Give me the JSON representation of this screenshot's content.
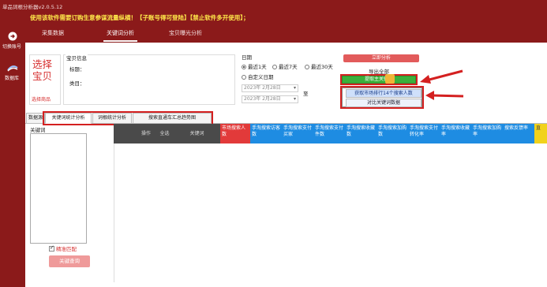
{
  "app": {
    "title": "单品词根分析器v2.0.5.12",
    "warning": "使用该软件需要订购生意参谋流量纵横！【子账号得可登陆】【禁止软件多开使用】；"
  },
  "sidebar": {
    "items": [
      {
        "label": "切换账号",
        "icon": "switch-account-icon"
      },
      {
        "label": "数据库",
        "icon": "database-icon"
      }
    ]
  },
  "nav": {
    "tabs": [
      {
        "label": "采集数据"
      },
      {
        "label": "关键词分析",
        "active": true
      },
      {
        "label": "宝贝曝光分析"
      }
    ]
  },
  "product": {
    "select_big": "选择宝贝",
    "select_small": "选择商品",
    "info_label": "宝贝信息",
    "title_label": "标题：",
    "category_label": "类目："
  },
  "date": {
    "label": "日期",
    "options": [
      "最近1天",
      "最近7天",
      "最近30天",
      "自定义日期"
    ],
    "selected": "最近1天",
    "start": "2023年  2月28日",
    "end": "2023年  2月28日",
    "to": "至"
  },
  "actions": {
    "analyze": "立即分析",
    "export": "导出全部",
    "copy": "提取主关键词",
    "menu_items": [
      "获取市场排行14个搜索人数",
      "对比关键词数据"
    ]
  },
  "subtabs": [
    {
      "label": "数据源"
    },
    {
      "label": "关键词统计分析",
      "active": true
    },
    {
      "label": "词根统计分析"
    },
    {
      "label": "搜索直通车汇总趋势图"
    }
  ],
  "keyword_panel": {
    "label": "关键词",
    "checkbox": "精准匹配",
    "search_button": "关键查询"
  },
  "grid": {
    "columns": [
      {
        "label": "",
        "color": "dark"
      },
      {
        "label": "操作",
        "color": "dark"
      },
      {
        "label": "全选",
        "color": "dark"
      },
      {
        "label": "关键词",
        "color": "dark"
      },
      {
        "label": "市场搜索人数",
        "color": "red"
      },
      {
        "label": "手淘搜索访客数",
        "color": "blue"
      },
      {
        "label": "手淘搜索支付买家",
        "color": "blue"
      },
      {
        "label": "手淘搜索支付件数",
        "color": "blue"
      },
      {
        "label": "手淘搜索收藏数",
        "color": "blue"
      },
      {
        "label": "手淘搜索加购数",
        "color": "blue"
      },
      {
        "label": "手淘搜索支付转化率",
        "color": "blue"
      },
      {
        "label": "手淘搜索收藏率",
        "color": "blue"
      },
      {
        "label": "手淘搜索加购率",
        "color": "blue"
      },
      {
        "label": "搜索反馈率",
        "color": "blue"
      },
      {
        "label": "直",
        "color": "yellow"
      }
    ]
  },
  "colors": {
    "brand": "#8b1a1a",
    "warning_text": "#ffe94a",
    "accent_red": "#e23a3a",
    "accent_blue": "#1e8ce2",
    "highlight": "#d42020"
  }
}
